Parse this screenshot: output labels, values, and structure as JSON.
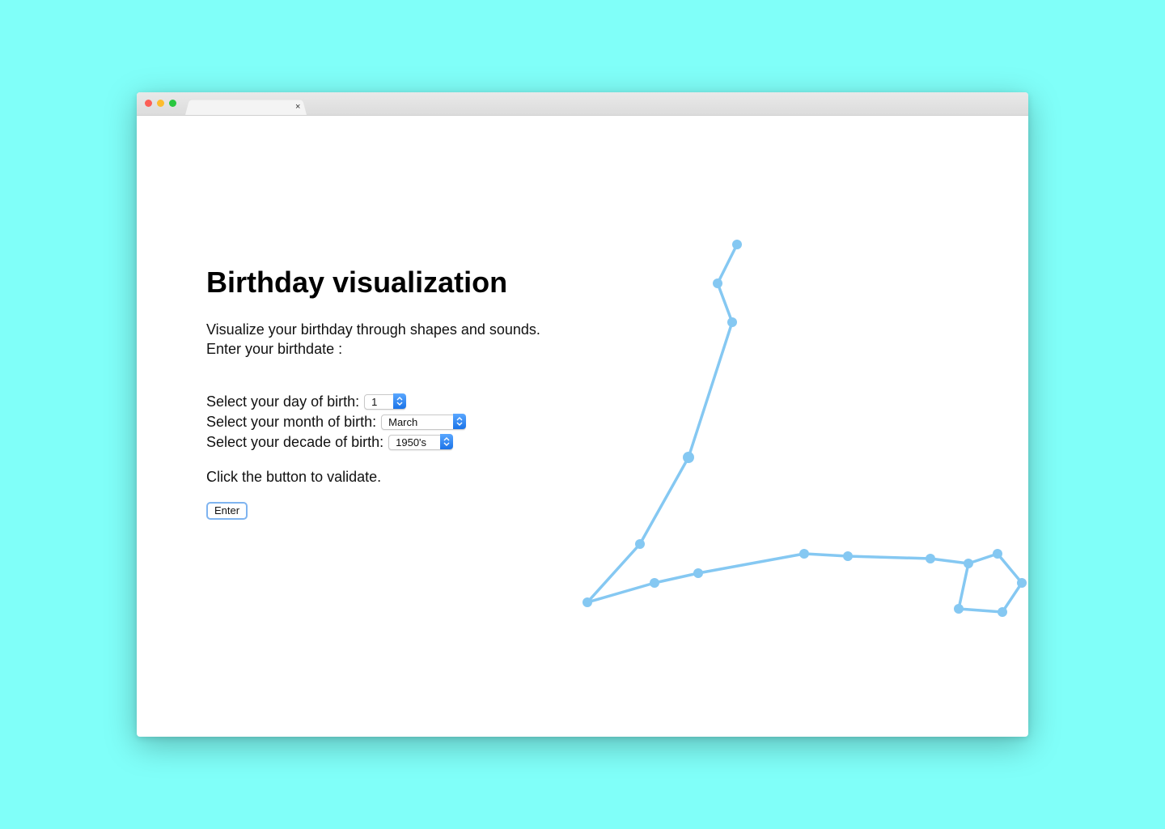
{
  "window": {
    "tab_close": "×"
  },
  "page": {
    "title": "Birthday visualization",
    "intro_line1": "Visualize your birthday through shapes and sounds.",
    "intro_line2": "Enter your birthdate :",
    "hint": "Click the button to validate.",
    "enter_label": "Enter"
  },
  "form": {
    "day_label": "Select your day of birth:",
    "day_value": "1",
    "month_label": "Select your month of birth:",
    "month_value": "March",
    "decade_label": "Select your decade of birth:",
    "decade_value": "1950's"
  },
  "colors": {
    "background": "#80fff9",
    "constellation": "#85c8f2",
    "select_accent": "#1a73e8"
  }
}
